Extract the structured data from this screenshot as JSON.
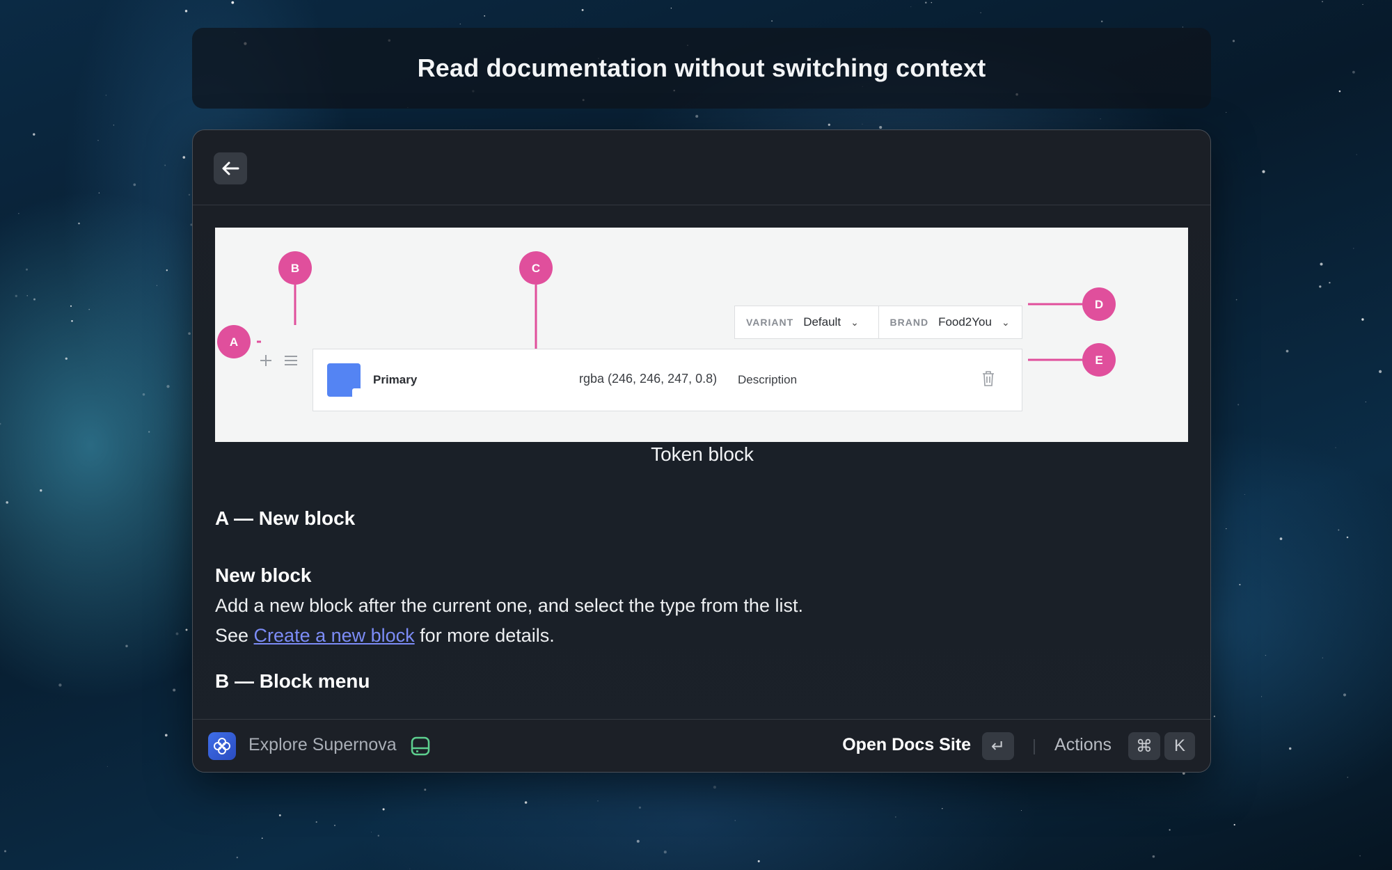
{
  "headline": "Read documentation without switching context",
  "window": {
    "back_icon": "arrow-left-icon"
  },
  "figure": {
    "annotations": [
      "A",
      "B",
      "C",
      "D",
      "E"
    ],
    "variant_label": "VARIANT",
    "variant_value": "Default",
    "brand_label": "BRAND",
    "brand_value": "Food2You",
    "token_name": "Primary",
    "token_value": "rgba (246, 246, 247, 0.8)",
    "token_description": "Description",
    "swatch_color": "#5484f3",
    "annotation_color": "#e04f9c",
    "caption": "Token block"
  },
  "doc": {
    "section_a": "A — New block",
    "sub_heading": "New block",
    "para_line1": "Add a new block after the current one, and select the type from the list.",
    "para_see": "See ",
    "para_link": "Create a new block",
    "para_after": " for more details.",
    "section_b": "B — Block menu",
    "link_color": "#7c8cf6"
  },
  "footer": {
    "app_name": "Explore Supernova",
    "open_docs": "Open Docs Site",
    "enter_key": "↵",
    "actions": "Actions",
    "cmd_key": "⌘",
    "k_key": "K"
  }
}
